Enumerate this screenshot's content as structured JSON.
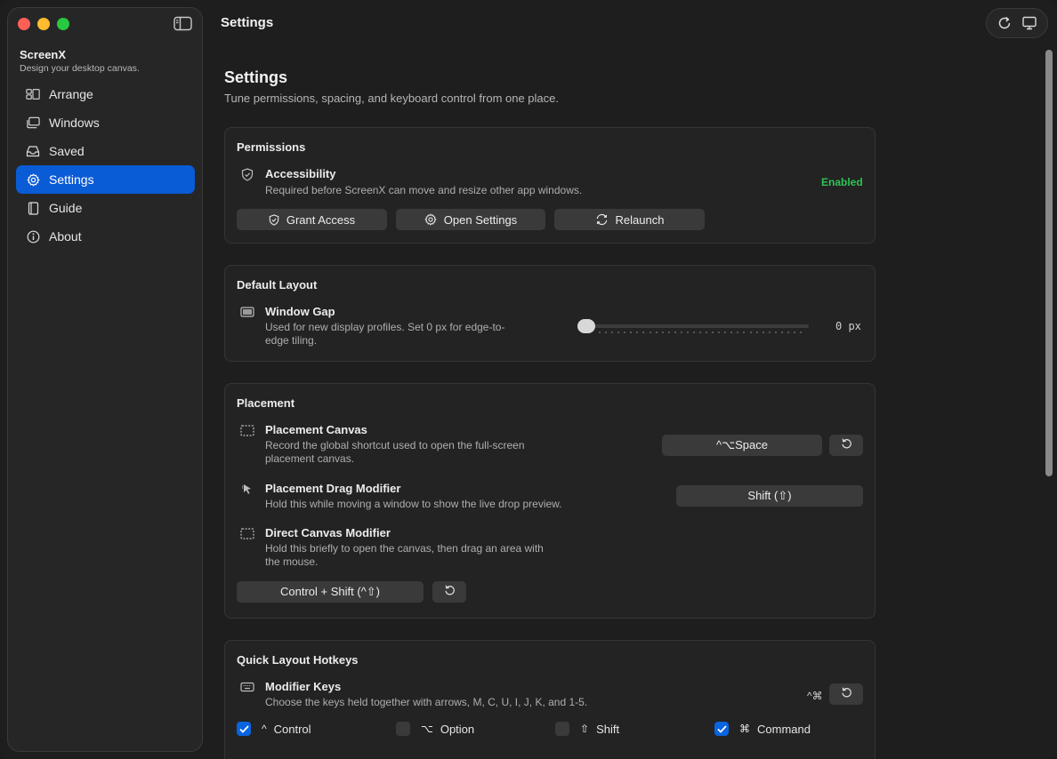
{
  "sidebar": {
    "app_name": "ScreenX",
    "tagline": "Design your desktop canvas.",
    "items": [
      {
        "label": "Arrange",
        "icon": "arrange-icon"
      },
      {
        "label": "Windows",
        "icon": "windows-icon"
      },
      {
        "label": "Saved",
        "icon": "tray-icon"
      },
      {
        "label": "Settings",
        "icon": "gear-icon",
        "active": true
      },
      {
        "label": "Guide",
        "icon": "book-icon"
      },
      {
        "label": "About",
        "icon": "info-icon"
      }
    ]
  },
  "header": {
    "title": "Settings"
  },
  "main": {
    "title": "Settings",
    "subtitle": "Tune permissions, spacing, and keyboard control from one place."
  },
  "permissions": {
    "title": "Permissions",
    "accessibility_title": "Accessibility",
    "accessibility_desc": "Required before ScreenX can move and resize other app windows.",
    "status": "Enabled",
    "grant_label": "Grant Access",
    "open_settings_label": "Open Settings",
    "relaunch_label": "Relaunch"
  },
  "default_layout": {
    "title": "Default Layout",
    "gap_title": "Window Gap",
    "gap_desc_1": "Used for new display profiles. Set 0 px for edge-to-",
    "gap_desc_2": "edge tiling.",
    "gap_value": 0,
    "gap_value_label": "0 px"
  },
  "placement": {
    "title": "Placement",
    "canvas_title": "Placement Canvas",
    "canvas_desc_1": "Record the global shortcut used to open the full-screen",
    "canvas_desc_2": "placement canvas.",
    "canvas_shortcut": "^⌥Space",
    "drag_title": "Placement Drag Modifier",
    "drag_desc": "Hold this while moving a window to show the live drop preview.",
    "drag_value": "Shift (⇧)",
    "direct_title": "Direct Canvas Modifier",
    "direct_desc_1": "Hold this briefly to open the canvas, then drag an area with",
    "direct_desc_2": "the mouse.",
    "direct_value": "Control + Shift (^⇧)"
  },
  "hotkeys": {
    "title": "Quick Layout Hotkeys",
    "modifier_title": "Modifier Keys",
    "modifier_desc": "Choose the keys held together with arrows, M, C, U, I, J, K, and 1-5.",
    "modifier_badge": "^⌘",
    "options": [
      {
        "symbol": "^",
        "label": "Control",
        "checked": true
      },
      {
        "symbol": "⌥",
        "label": "Option",
        "checked": false
      },
      {
        "symbol": "⇧",
        "label": "Shift",
        "checked": false
      },
      {
        "symbol": "⌘",
        "label": "Command",
        "checked": true
      }
    ]
  },
  "colors": {
    "accent": "#0a5bd6",
    "enabled": "#2ec254"
  }
}
